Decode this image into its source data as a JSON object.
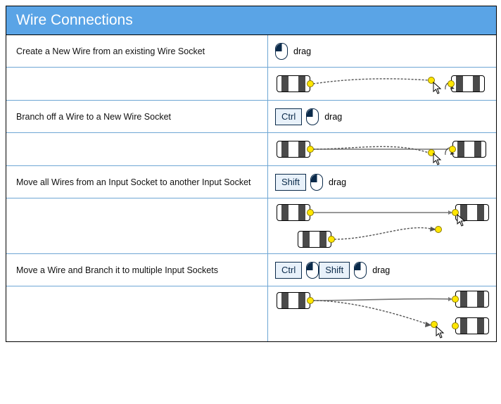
{
  "panel": {
    "title": "Wire Connections"
  },
  "keys": {
    "ctrl": "Ctrl",
    "shift": "Shift"
  },
  "actions": {
    "drag": "drag",
    "basic": "Create a New Wire from an existing Wire Socket",
    "branch": "Branch off a Wire to a New Wire Socket",
    "move": "Move all Wires from an Input Socket to another Input Socket",
    "movebranch": "Move a Wire and Branch it to multiple Input Sockets"
  }
}
